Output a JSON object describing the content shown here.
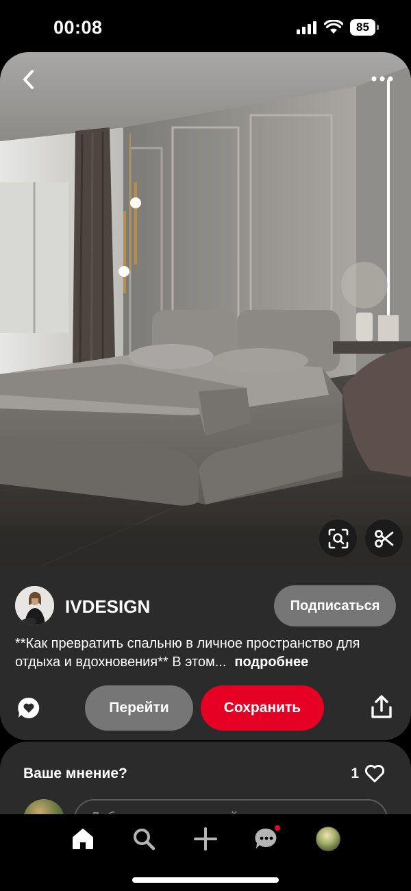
{
  "status_bar": {
    "time": "00:08",
    "battery": "85"
  },
  "pin": {
    "image_icon": "bedroom-interior-photo",
    "creator": {
      "name": "IVDESIGN",
      "follow_label": "Подписаться"
    },
    "description": "**Как превратить спальню в личное пространство для отдыха и вдохновения** В этом...",
    "more_label": "подробнее",
    "actions": {
      "go_label": "Перейти",
      "save_label": "Сохранить"
    }
  },
  "comments": {
    "title": "Ваше мнение?",
    "likes_count": "1",
    "input_placeholder": "Добавьте комментарий"
  },
  "colors": {
    "accent": "#e60023",
    "card_bg": "#2b2b2b",
    "secondary_button": "#767676"
  }
}
